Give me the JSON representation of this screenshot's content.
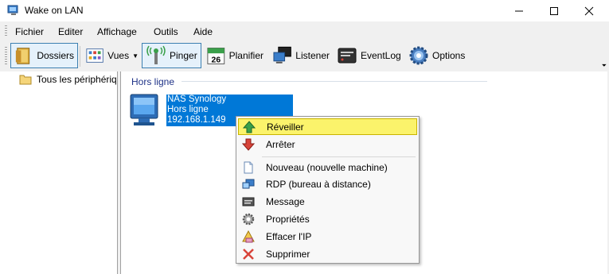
{
  "window": {
    "title": "Wake on LAN"
  },
  "menubar": {
    "items": [
      "Fichier",
      "Editer",
      "Affichage",
      "Outils",
      "Aide"
    ]
  },
  "toolbar": {
    "dossiers": "Dossiers",
    "vues": "Vues",
    "pinger": "Pinger",
    "planifier": "Planifier",
    "planifier_day": "26",
    "listener": "Listener",
    "eventlog": "EventLog",
    "options": "Options"
  },
  "tree": {
    "root": "Tous les périphérique"
  },
  "group": {
    "title": "Hors ligne"
  },
  "device": {
    "name": "NAS Synology",
    "status": "Hors ligne",
    "ip": "192.168.1.149"
  },
  "context_menu": {
    "items": [
      "Réveiller",
      "Arrêter",
      "Nouveau (nouvelle machine)",
      "RDP (bureau à distance)",
      "Message",
      "Propriétés",
      "Effacer l'IP",
      "Supprimer"
    ]
  },
  "colors": {
    "selection": "#0078d7",
    "highlight": "#fbf36b",
    "group_header": "#1e3287"
  }
}
